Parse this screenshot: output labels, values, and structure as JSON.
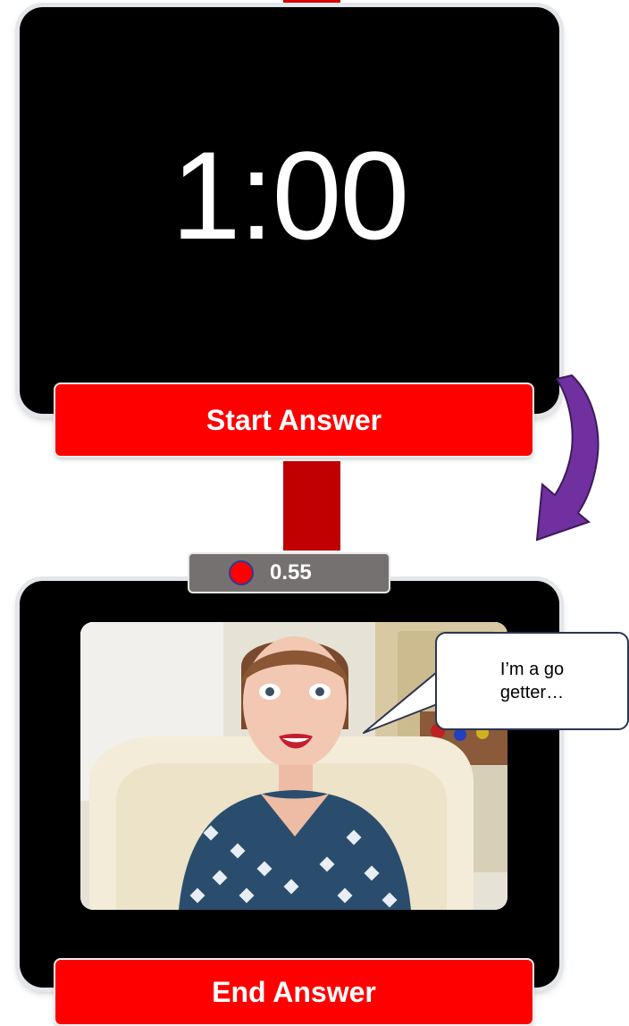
{
  "timer": {
    "display": "1:00"
  },
  "start_button": {
    "label": "Start Answer"
  },
  "end_button": {
    "label": "End Answer"
  },
  "recording": {
    "elapsed": "0.55"
  },
  "speech_bubble": {
    "text": "I’m a go getter…"
  },
  "icons": {
    "arrow": "curved-down-arrow-icon",
    "record": "record-dot-icon"
  },
  "colors": {
    "button_red": "#ff0000",
    "connector_red": "#c00000",
    "arrow_purple": "#7030a0",
    "panel_black": "#000000",
    "recording_bar": "#767171"
  }
}
